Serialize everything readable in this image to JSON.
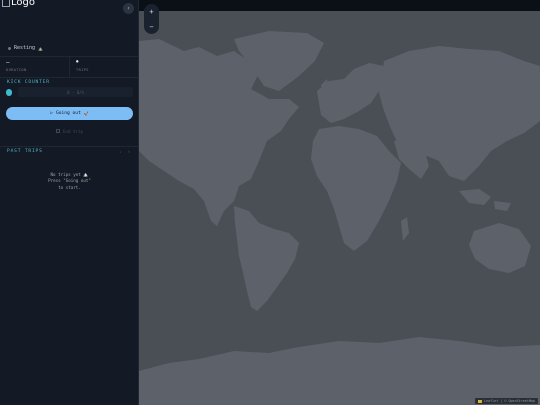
{
  "brand": {
    "logo_alt": "Logo"
  },
  "sidebar": {
    "collapse_icon": "chevron-left-icon",
    "status": {
      "label": "Resting",
      "emoji": "⛰️"
    },
    "stats": [
      {
        "value": "—",
        "label": "DURATION",
        "icon": ""
      },
      {
        "value": "0",
        "label": "TRIPS",
        "icon": "trip-icon"
      }
    ],
    "kick_counter": {
      "title": "KICK COUNTER",
      "field_text": "0 · 0/h",
      "icon": "kick-icon"
    },
    "going_out": {
      "label": "Going out",
      "suffix": "🚀"
    },
    "end_trip": {
      "label": "End trip"
    },
    "past_trips": {
      "title": "PAST TRIPS",
      "action_a": "↓",
      "action_b": "✕"
    },
    "empty_state": {
      "line1": "No trips yet 🏔️",
      "line2": "Press \"Going out\"",
      "line3": "to start."
    }
  },
  "map": {
    "zoom_in": "+",
    "zoom_out": "−",
    "attribution": "Leaflet | © OpenStreetMap",
    "land_color": "#5d6169",
    "sea_color": "#4a4f56"
  }
}
